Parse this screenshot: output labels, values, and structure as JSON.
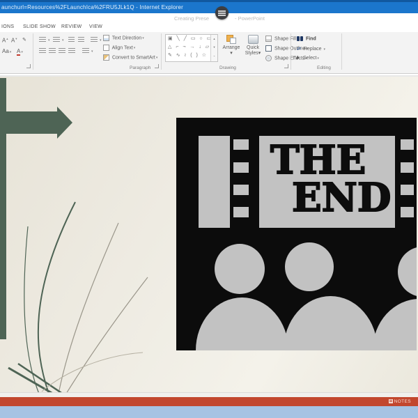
{
  "titlebar": {
    "title": "aunchurl=Resources%2FLaunchIca%2FRU5JLk1Q - Internet Explorer"
  },
  "app": {
    "doc_title": "Creating Prese",
    "app_name": "- PowerPoint"
  },
  "tabs": [
    "IONS",
    "SLIDE SHOW",
    "REVIEW",
    "VIEW"
  ],
  "icons": {
    "chevron": "▾",
    "up_arrow": "▴",
    "down_arrow": "▾",
    "more_arrow": "⌄",
    "grow_font": "A",
    "shrink_font": "A",
    "change_case": "Aa",
    "font_color": "A",
    "swap": "⇄"
  },
  "paragraph": {
    "label": "Paragraph",
    "text_direction": "Text Direction",
    "align_text": "Align Text",
    "smartart": "Convert to SmartArt"
  },
  "drawing": {
    "label": "Drawing",
    "shapes_rows": [
      "▣ ╲ ╱ ▭ ○ ▭",
      "△ ⌐ ¬ → ↓ ▱",
      "✎ ∿ ≀ ( ) ☆"
    ],
    "arrange": "Arrange",
    "quick1": "Quick",
    "quick2": "Styles",
    "shape_fill": "Shape Fill",
    "shape_outline": "Shape Outline",
    "shape_effects": "Shape Effects"
  },
  "editing": {
    "label": "Editing",
    "find": "Find",
    "replace": "Replace",
    "select": "Select"
  },
  "slide": {
    "line1": "THE",
    "line2": "END"
  },
  "status": {
    "notes": "NOTES"
  },
  "colors": {
    "titlebar_blue": "#1b76cc",
    "status_red": "#c2472e",
    "slide_beige": "#edeae0",
    "cross_green": "#4e6455",
    "clip_black": "#0c0c0c",
    "clip_gray": "#c2c2c2",
    "desktop_blue": "#a6c3e3"
  }
}
